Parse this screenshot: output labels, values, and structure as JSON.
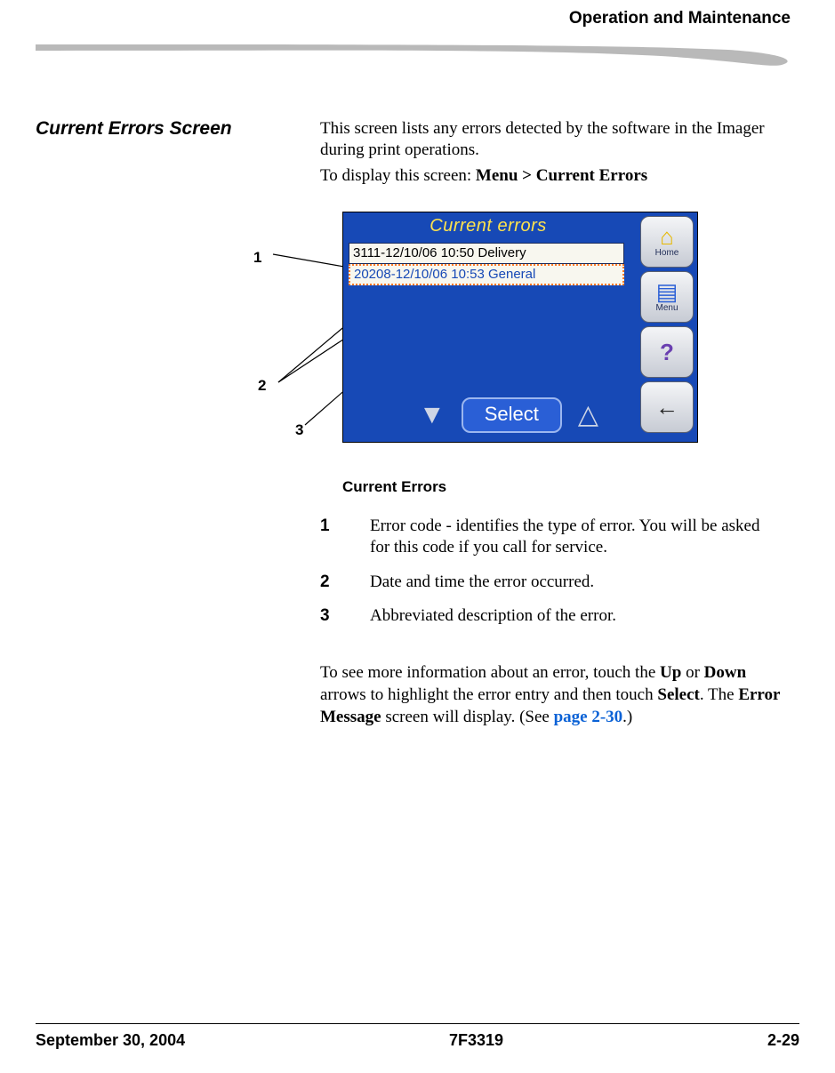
{
  "header": {
    "running": "Operation and Maintenance"
  },
  "section": {
    "title": "Current Errors Screen",
    "intro_a": "This screen lists any errors detected by the software in the Imager during print operations.",
    "intro_b_prefix": "To display this screen: ",
    "intro_b_bold": "Menu > Current Errors"
  },
  "callouts": {
    "one": "1",
    "two": "2",
    "three": "3"
  },
  "device": {
    "title": "Current errors",
    "rows": [
      "3111-12/10/06 10:50 Delivery",
      "20208-12/10/06 10:53 General"
    ],
    "side": {
      "home": "Home",
      "menu": "Menu"
    },
    "select": "Select"
  },
  "caption": "Current Errors",
  "legend": [
    {
      "n": "1",
      "t": "Error code - identifies the type of error. You will be asked for this code if you call for service."
    },
    {
      "n": "2",
      "t": "Date and time the error occurred."
    },
    {
      "n": "3",
      "t": "Abbreviated description of the error."
    }
  ],
  "after": {
    "pre": "To see more information about an error, touch the ",
    "up": "Up",
    "mid1": " or ",
    "down": "Down",
    "mid2": " arrows to highlight the error entry and then touch ",
    "select": "Select",
    "mid3": ". The ",
    "errmsg": "Error Message",
    "mid4": " screen will display. (See ",
    "link": "page 2-30",
    "tail": ".)"
  },
  "footer": {
    "left": "September 30, 2004",
    "center": "7F3319",
    "right": "2-29"
  }
}
